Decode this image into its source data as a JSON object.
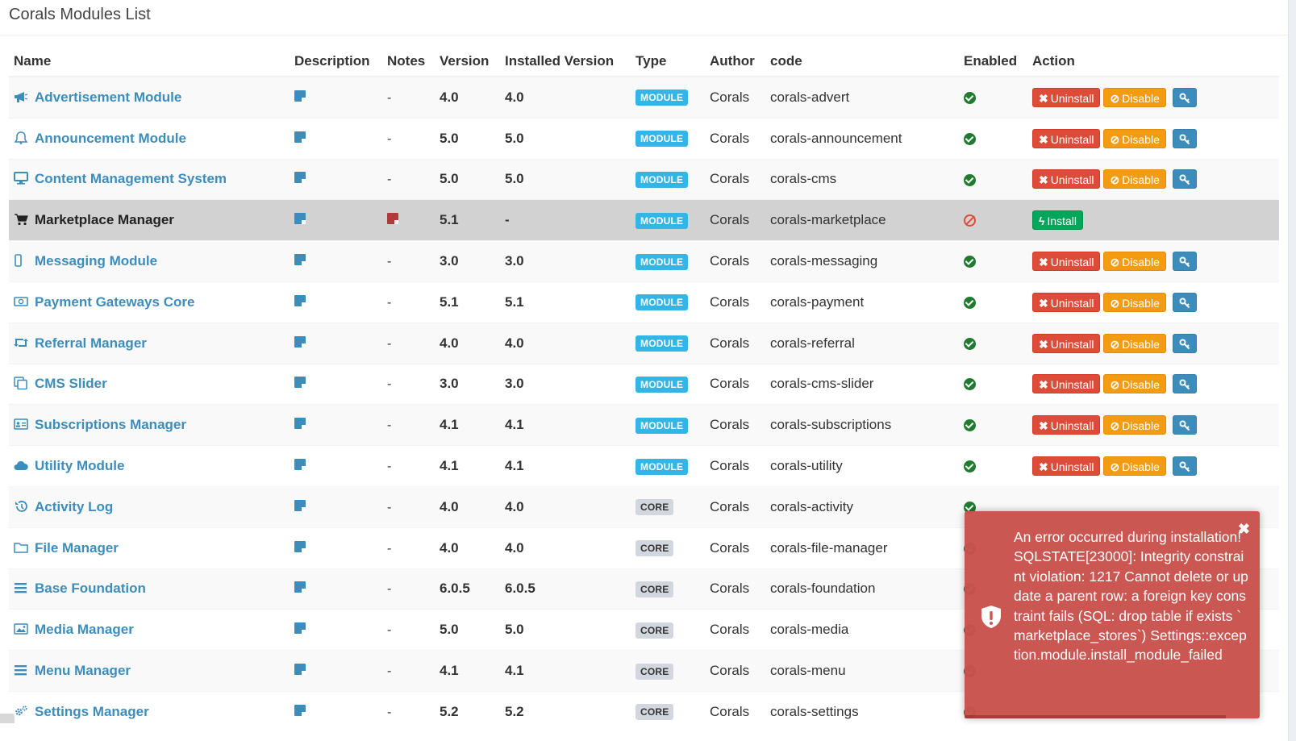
{
  "page": {
    "title": "Corals Modules List"
  },
  "columns": [
    "Name",
    "Description",
    "Notes",
    "Version",
    "Installed Version",
    "Type",
    "Author",
    "code",
    "Enabled",
    "Action"
  ],
  "buttons": {
    "uninstall": "Uninstall",
    "disable": "Disable",
    "install": "Install"
  },
  "rows": [
    {
      "name": "Advertisement Module",
      "icon": "bullhorn-icon",
      "notes": "-",
      "version": "4.0",
      "installed": "4.0",
      "type": "MODULE",
      "author": "Corals",
      "code": "corals-advert",
      "enabled": true
    },
    {
      "name": "Announcement Module",
      "icon": "bell-icon",
      "notes": "-",
      "version": "5.0",
      "installed": "5.0",
      "type": "MODULE",
      "author": "Corals",
      "code": "corals-announcement",
      "enabled": true
    },
    {
      "name": "Content Management System",
      "icon": "desktop-icon",
      "notes": "-",
      "version": "5.0",
      "installed": "5.0",
      "type": "MODULE",
      "author": "Corals",
      "code": "corals-cms",
      "enabled": true
    },
    {
      "name": "Marketplace Manager",
      "icon": "shopping-cart-icon",
      "notes": "",
      "version": "5.1",
      "installed": "-",
      "type": "MODULE",
      "author": "Corals",
      "code": "corals-marketplace",
      "enabled": false
    },
    {
      "name": "Messaging Module",
      "icon": "mobile-icon",
      "notes": "-",
      "version": "3.0",
      "installed": "3.0",
      "type": "MODULE",
      "author": "Corals",
      "code": "corals-messaging",
      "enabled": true
    },
    {
      "name": "Payment Gateways Core",
      "icon": "money-icon",
      "notes": "-",
      "version": "5.1",
      "installed": "5.1",
      "type": "MODULE",
      "author": "Corals",
      "code": "corals-payment",
      "enabled": true
    },
    {
      "name": "Referral Manager",
      "icon": "retweet-icon",
      "notes": "-",
      "version": "4.0",
      "installed": "4.0",
      "type": "MODULE",
      "author": "Corals",
      "code": "corals-referral",
      "enabled": true
    },
    {
      "name": "CMS Slider",
      "icon": "clone-icon",
      "notes": "-",
      "version": "3.0",
      "installed": "3.0",
      "type": "MODULE",
      "author": "Corals",
      "code": "corals-cms-slider",
      "enabled": true
    },
    {
      "name": "Subscriptions Manager",
      "icon": "id-card-icon",
      "notes": "-",
      "version": "4.1",
      "installed": "4.1",
      "type": "MODULE",
      "author": "Corals",
      "code": "corals-subscriptions",
      "enabled": true
    },
    {
      "name": "Utility Module",
      "icon": "cloud-icon",
      "notes": "-",
      "version": "4.1",
      "installed": "4.1",
      "type": "MODULE",
      "author": "Corals",
      "code": "corals-utility",
      "enabled": true
    },
    {
      "name": "Activity Log",
      "icon": "history-icon",
      "notes": "-",
      "version": "4.0",
      "installed": "4.0",
      "type": "CORE",
      "author": "Corals",
      "code": "corals-activity",
      "enabled": true
    },
    {
      "name": "File Manager",
      "icon": "folder-icon",
      "notes": "-",
      "version": "4.0",
      "installed": "4.0",
      "type": "CORE",
      "author": "Corals",
      "code": "corals-file-manager",
      "enabled": true
    },
    {
      "name": "Base Foundation",
      "icon": "bars-icon",
      "notes": "-",
      "version": "6.0.5",
      "installed": "6.0.5",
      "type": "CORE",
      "author": "Corals",
      "code": "corals-foundation",
      "enabled": true
    },
    {
      "name": "Media Manager",
      "icon": "image-icon",
      "notes": "-",
      "version": "5.0",
      "installed": "5.0",
      "type": "CORE",
      "author": "Corals",
      "code": "corals-media",
      "enabled": true
    },
    {
      "name": "Menu Manager",
      "icon": "bars-icon",
      "notes": "-",
      "version": "4.1",
      "installed": "4.1",
      "type": "CORE",
      "author": "Corals",
      "code": "corals-menu",
      "enabled": true
    },
    {
      "name": "Settings Manager",
      "icon": "cogs-icon",
      "notes": "-",
      "version": "5.2",
      "installed": "5.2",
      "type": "CORE",
      "author": "Corals",
      "code": "corals-settings",
      "enabled": true
    }
  ],
  "toast": {
    "message": "An error occurred during installation! SQLSTATE[23000]: Integrity constraint violation: 1217 Cannot delete or update a parent row: a foreign key constraint fails (SQL: drop table if exists `marketplace_stores`) Settings::exception.module.install_module_failed",
    "close": "✖"
  },
  "colors": {
    "link": "#3c8dbc",
    "danger": "#dd4b39",
    "warning": "#f39c12",
    "success": "#00a65a",
    "toast": "#c9524d"
  }
}
